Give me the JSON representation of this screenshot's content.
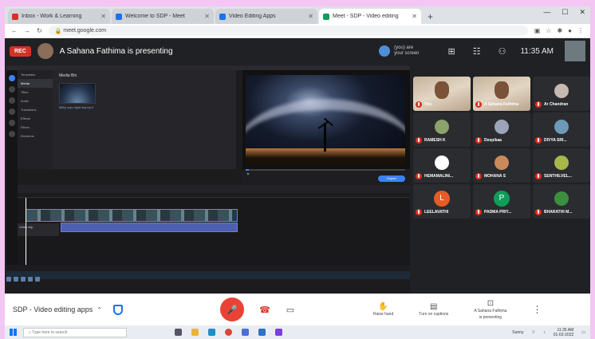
{
  "browser": {
    "tabs": [
      {
        "label": "Inbox - Work & Learning",
        "active": false,
        "color": "#d93025"
      },
      {
        "label": "Welcome to SDP - Meet",
        "active": false,
        "color": "#1a73e8"
      },
      {
        "label": "Video Editing Apps",
        "active": false,
        "color": "#1a73e8"
      },
      {
        "label": "Meet - SDP - Video editing",
        "active": true,
        "color": "#0f9d58"
      }
    ],
    "new_tab": "+",
    "url": "meet.google.com",
    "window_controls": [
      "minimize",
      "maximize",
      "close"
    ]
  },
  "meet": {
    "rec_label": "REC",
    "presenting_text": "A Sahana Fathima is presenting",
    "you_presenting_line1": "(you) are",
    "you_presenting_line2": "your screen",
    "clock": "11:35 AM",
    "top_icons": [
      "layout-icon",
      "activities-icon",
      "people-icon"
    ]
  },
  "editor": {
    "library_title": "Media Bin",
    "clip_caption": "Milky way night sky.mp4",
    "sidebar": [
      "Templates",
      "Media",
      "Titles",
      "Audio",
      "Transitions",
      "Effects",
      "Filters",
      "Elements"
    ],
    "export_label": "Export",
    "clip_label": "Video clip",
    "progress": 0.02
  },
  "participants": [
    {
      "name": "You",
      "type": "camera"
    },
    {
      "name": "A Sahana Fathima",
      "type": "camera"
    },
    {
      "name": "Ar Chandran",
      "type": "avatar",
      "color": "#c7b8b0"
    },
    {
      "name": "RAMESH K",
      "type": "avatar",
      "color": "#8ba36a"
    },
    {
      "name": "Deepikaa",
      "type": "avatar",
      "color": "#9da3b8"
    },
    {
      "name": "DIVYA SRI...",
      "type": "avatar",
      "color": "#6d9ab8"
    },
    {
      "name": "HEMAMALINI...",
      "type": "avatar",
      "color": "#ffffff"
    },
    {
      "name": "MOHANA S",
      "type": "avatar",
      "color": "#c98a5c"
    },
    {
      "name": "SENTHILVEL...",
      "type": "avatar",
      "color": "#a8b64a"
    },
    {
      "name": "LEELAVATHI",
      "type": "initial",
      "initial": "L",
      "color": "#e65c26"
    },
    {
      "name": "PADMA PRIY...",
      "type": "initial",
      "initial": "P",
      "color": "#0f9d58"
    },
    {
      "name": "BHARATHI M...",
      "type": "avatar",
      "color": "#3b8f3f"
    }
  ],
  "bottombar": {
    "meeting_name": "SDP - Video editing apps",
    "raise_hand": "Raise hand",
    "captions": "Turn on captions",
    "present_line1": "A Sahana Fathima",
    "present_line2": "is presenting"
  },
  "taskbar": {
    "search_placeholder": "Type here to search",
    "weather": "Sunny",
    "time": "11:35 AM",
    "date": "01-02-2022"
  }
}
